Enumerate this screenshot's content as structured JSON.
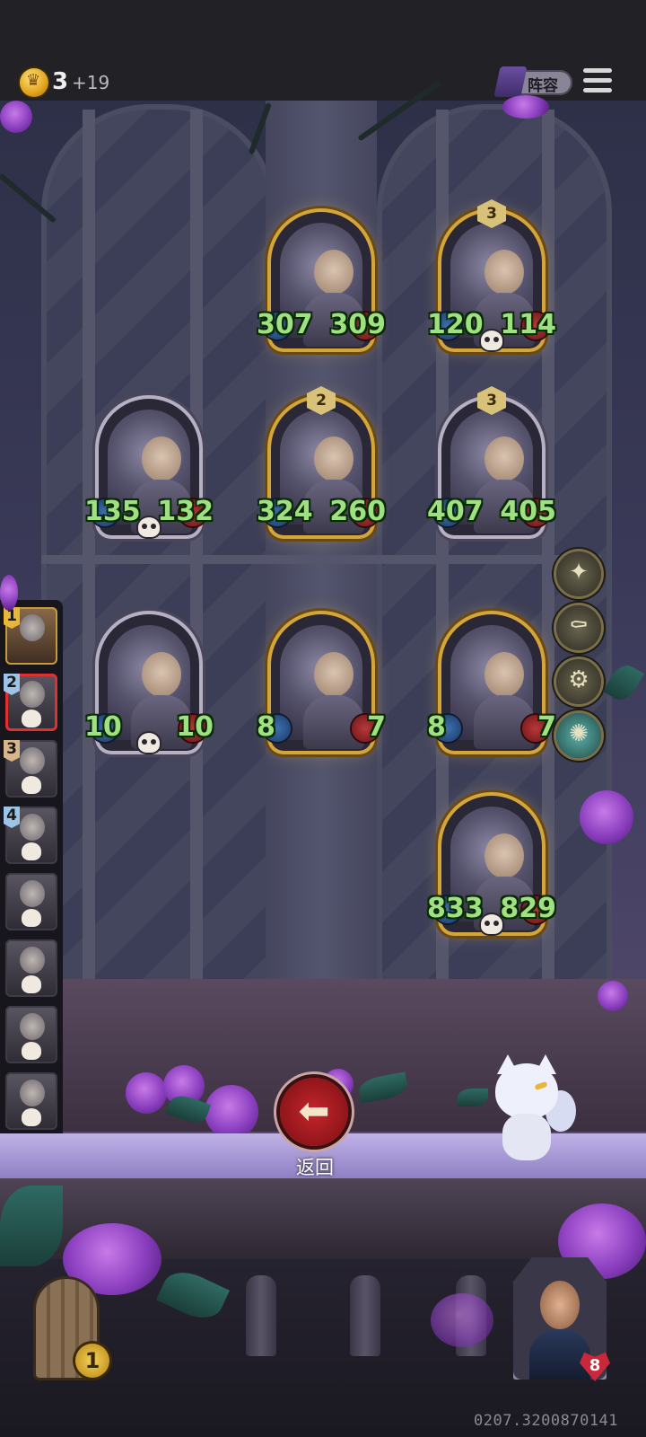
{
  "top_bar": {
    "gold": "3",
    "income": "+19",
    "lineup_label": "阵容"
  },
  "units": [
    {
      "tier": "",
      "attack": "307",
      "health": "309"
    },
    {
      "tier": "3",
      "attack": "120",
      "health": "114"
    },
    {
      "tier": "",
      "attack": "135",
      "health": "132"
    },
    {
      "tier": "2",
      "attack": "324",
      "health": "260"
    },
    {
      "tier": "3",
      "attack": "407",
      "health": "405"
    },
    {
      "tier": "",
      "attack": "10",
      "health": "10"
    },
    {
      "tier": "",
      "attack": "8",
      "health": "7"
    },
    {
      "tier": "",
      "attack": "8",
      "health": "7"
    },
    {
      "tier": "",
      "attack": "833",
      "health": "829"
    }
  ],
  "roster": [
    {
      "number": "1"
    },
    {
      "number": "2"
    },
    {
      "number": "3"
    },
    {
      "number": "4"
    },
    {
      "number": ""
    },
    {
      "number": ""
    },
    {
      "number": ""
    },
    {
      "number": ""
    }
  ],
  "equipment": [
    "star-wand-icon",
    "coffin-icon",
    "clockwork-icon",
    "swirl-orb-icon"
  ],
  "back_button": {
    "label": "返回"
  },
  "chest": {
    "count": "1"
  },
  "hero": {
    "health": "8"
  },
  "build_id": "0207.3200870141"
}
